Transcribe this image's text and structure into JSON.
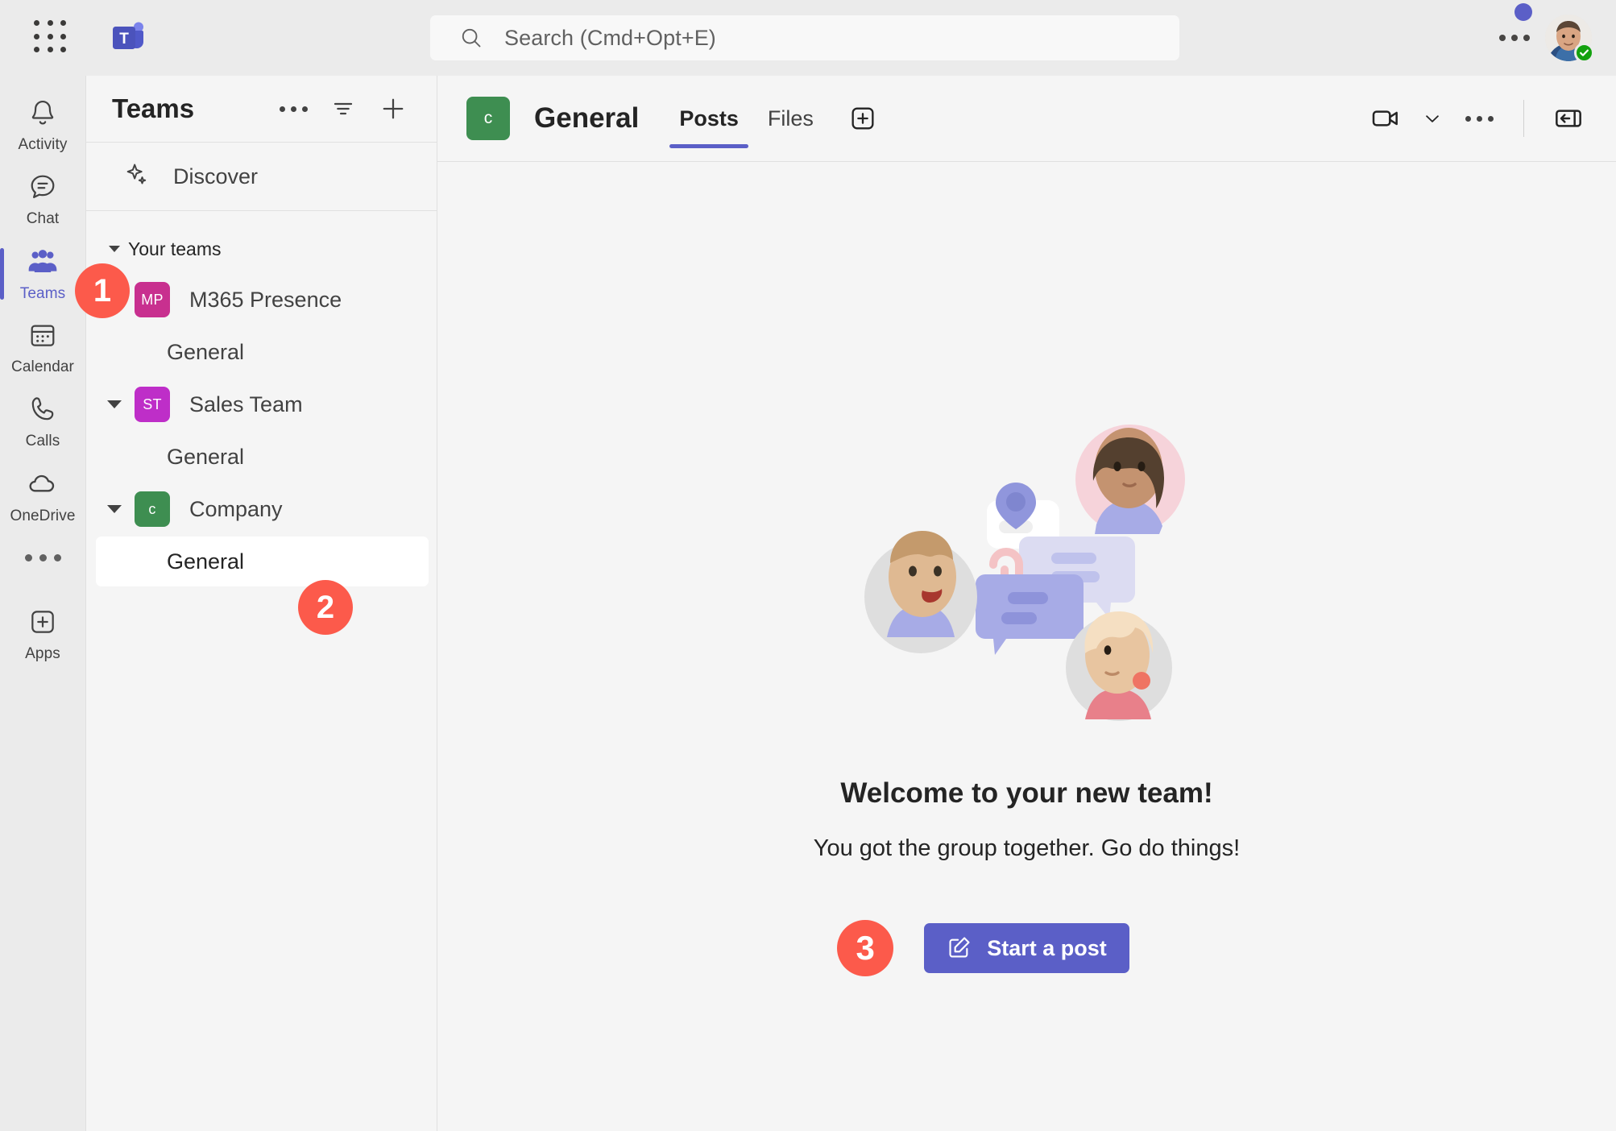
{
  "titlebar": {
    "waffle_icon": "app-launcher-icon",
    "logo_icon": "teams-logo-icon",
    "search": {
      "icon": "search-icon",
      "placeholder": "Search (Cmd+Opt+E)",
      "value": ""
    },
    "more_icon": "ellipsis-icon",
    "avatar": {
      "name": "user-avatar",
      "presence": "available",
      "presence_color": "#13A10E"
    },
    "notification_dot_color": "#5B5FC7"
  },
  "rail": {
    "items": [
      {
        "label": "Activity",
        "icon": "bell-icon",
        "active": false
      },
      {
        "label": "Chat",
        "icon": "chat-bubble-icon",
        "active": false
      },
      {
        "label": "Teams",
        "icon": "people-icon",
        "active": true
      },
      {
        "label": "Calendar",
        "icon": "calendar-icon",
        "active": false
      },
      {
        "label": "Calls",
        "icon": "phone-icon",
        "active": false
      },
      {
        "label": "OneDrive",
        "icon": "cloud-icon",
        "active": false
      }
    ],
    "more_icon": "ellipsis-icon",
    "apps": {
      "label": "Apps",
      "icon": "plus-box-icon"
    },
    "active_color": "#5B5FC7"
  },
  "sidebar": {
    "title": "Teams",
    "header_icons": [
      {
        "name": "more-options-icon",
        "glyph": "ellipsis"
      },
      {
        "name": "filter-icon",
        "glyph": "filter"
      },
      {
        "name": "join-or-create-team-icon",
        "glyph": "plus"
      }
    ],
    "discover": {
      "label": "Discover",
      "icon": "sparkle-icon"
    },
    "your_teams_label": "Your teams",
    "teams": [
      {
        "name": "M365 Presence",
        "initials": "MP",
        "color": "#C8308F",
        "expanded": true,
        "channels": [
          {
            "name": "General",
            "selected": false
          }
        ]
      },
      {
        "name": "Sales Team",
        "initials": "ST",
        "color": "#BE2EC8",
        "expanded": true,
        "channels": [
          {
            "name": "General",
            "selected": false
          }
        ]
      },
      {
        "name": "Company",
        "initials": "c",
        "color": "#3E8E51",
        "expanded": true,
        "channels": [
          {
            "name": "General",
            "selected": true
          }
        ]
      }
    ]
  },
  "main": {
    "channel": {
      "name": "General",
      "team_initials": "c",
      "team_color": "#3E8E51"
    },
    "tabs": [
      {
        "label": "Posts",
        "active": true
      },
      {
        "label": "Files",
        "active": false
      }
    ],
    "add_tab_icon": "add-tab-icon",
    "header_actions": [
      {
        "name": "meet-now-icon",
        "glyph": "video"
      },
      {
        "name": "chevron-down-icon",
        "glyph": "chevron"
      },
      {
        "name": "more-options-icon",
        "glyph": "ellipsis"
      },
      {
        "name": "collapse-panel-icon",
        "glyph": "panel"
      }
    ],
    "empty_state": {
      "illustration": "team-collaboration-illustration",
      "title": "Welcome to your new team!",
      "subtitle": "You got the group together. Go do things!",
      "button": {
        "label": "Start a post",
        "icon": "compose-icon",
        "color": "#5B5FC7"
      }
    }
  },
  "callouts": [
    {
      "number": "1",
      "target": "rail-item-teams"
    },
    {
      "number": "2",
      "target": "channel-general-company"
    },
    {
      "number": "3",
      "target": "start-a-post-button"
    }
  ]
}
